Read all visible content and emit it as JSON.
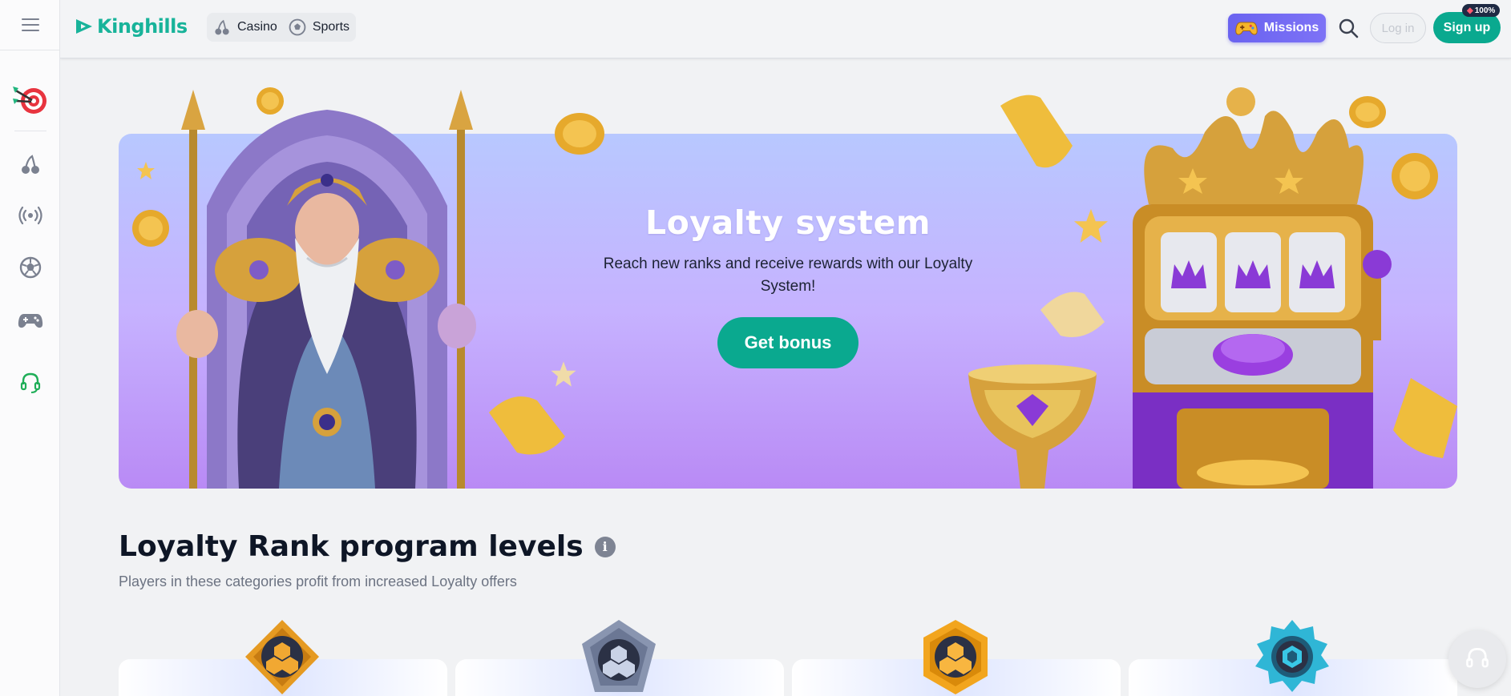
{
  "header": {
    "logo_text": "Kinghills",
    "nav": [
      {
        "label": "Casino",
        "icon": "cherries-icon"
      },
      {
        "label": "Sports",
        "icon": "soccer-ball-icon"
      }
    ],
    "missions_label": "Missions",
    "login_label": "Log in",
    "signup_label": "Sign up",
    "signup_badge": "100%"
  },
  "sidebar": {
    "items": [
      {
        "name": "missions-target",
        "icon": "dart-target-icon"
      },
      {
        "name": "casino",
        "icon": "cherries-icon"
      },
      {
        "name": "live",
        "icon": "broadcast-icon"
      },
      {
        "name": "sports",
        "icon": "soccer-ball-icon"
      },
      {
        "name": "games",
        "icon": "gamepad-icon"
      },
      {
        "name": "support",
        "icon": "headset-icon"
      }
    ]
  },
  "banner": {
    "title": "Loyalty system",
    "subtitle": "Reach new ranks and receive rewards with our Loyalty System!",
    "cta_label": "Get bonus"
  },
  "section": {
    "title": "Loyalty Rank program levels",
    "subtitle": "Players in these categories profit from increased Loyalty offers"
  },
  "ranks": [
    {
      "badge": "bronze-rank-icon"
    },
    {
      "badge": "silver-rank-icon"
    },
    {
      "badge": "gold-rank-icon"
    },
    {
      "badge": "diamond-rank-icon"
    }
  ],
  "colors": {
    "accent": "#0aa98f",
    "missions": "#6a63f0",
    "banner_top": "#b8c8ff",
    "banner_bottom": "#b98af5"
  }
}
